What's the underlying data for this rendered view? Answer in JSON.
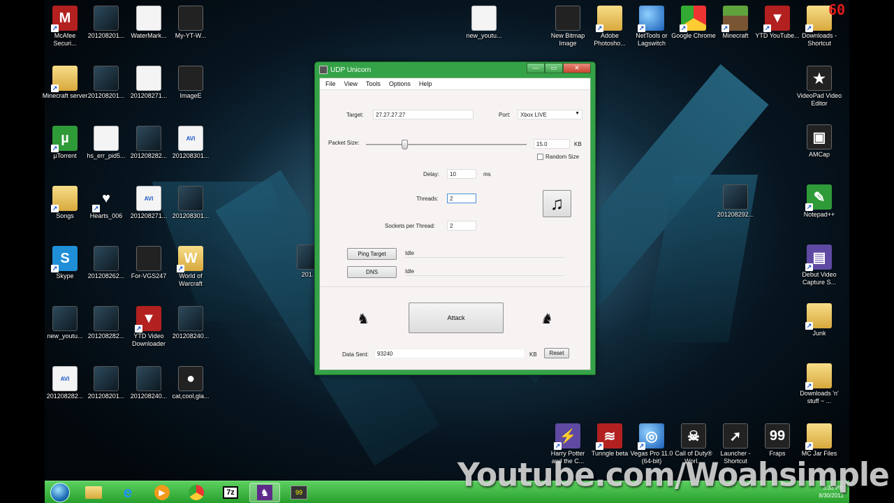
{
  "desktop": {
    "icons_left": [
      {
        "label": "McAfee Securi...",
        "icon": "mcafee-icon"
      },
      {
        "label": "201208201...",
        "icon": "video-thumb-icon"
      },
      {
        "label": "WaterMark...",
        "icon": "document-icon"
      },
      {
        "label": "My-YT-W...",
        "icon": "app-icon"
      },
      {
        "label": "Minecraft server",
        "icon": "folder-icon"
      },
      {
        "label": "201208201...",
        "icon": "video-thumb-icon"
      },
      {
        "label": "201208271...",
        "icon": "document-icon"
      },
      {
        "label": "ImageE",
        "icon": "app-icon"
      },
      {
        "label": "µTorrent",
        "icon": "utorrent-icon"
      },
      {
        "label": "hs_err_pid5...",
        "icon": "document-icon"
      },
      {
        "label": "201208282...",
        "icon": "video-thumb-icon"
      },
      {
        "label": "201208301...",
        "icon": "avi-icon"
      },
      {
        "label": "Songs",
        "icon": "folder-icon"
      },
      {
        "label": "Hearts_006",
        "icon": "heart-icon"
      },
      {
        "label": "201208271...",
        "icon": "avi-icon"
      },
      {
        "label": "201208301...",
        "icon": "video-thumb-icon"
      },
      {
        "label": "Skype",
        "icon": "skype-icon"
      },
      {
        "label": "201208262...",
        "icon": "video-thumb-icon"
      },
      {
        "label": "For-VGS247",
        "icon": "app-icon"
      },
      {
        "label": "World of Warcraft",
        "icon": "wow-icon"
      },
      {
        "label": "new_youtu...",
        "icon": "video-thumb-icon"
      },
      {
        "label": "201208282...",
        "icon": "video-thumb-icon"
      },
      {
        "label": "YTD Video Downloader",
        "icon": "ytd-icon"
      },
      {
        "label": "201208240...",
        "icon": "video-thumb-icon"
      },
      {
        "label": "201208282...",
        "icon": "avi-icon"
      },
      {
        "label": "201208201...",
        "icon": "video-thumb-icon"
      },
      {
        "label": "201208240...",
        "icon": "video-thumb-icon"
      },
      {
        "label": "cat,cool,gla...",
        "icon": "image-icon"
      }
    ],
    "icons_top": [
      {
        "label": "new_youtu...",
        "icon": "document-icon"
      },
      {
        "label": "New Bitmap Image",
        "icon": "bitmap-icon"
      },
      {
        "label": "Adobe Photosho...",
        "icon": "folder-icon"
      },
      {
        "label": "NetTools or Lagswitch",
        "icon": "globe-icon"
      },
      {
        "label": "Google Chrome",
        "icon": "chrome-icon"
      },
      {
        "label": "Minecraft",
        "icon": "minecraft-icon"
      },
      {
        "label": "YTD YouTube...",
        "icon": "ytd-icon"
      },
      {
        "label": "Downloads - Shortcut",
        "icon": "folder-icon"
      }
    ],
    "icons_right": [
      {
        "label": "VideoPad Video Editor",
        "icon": "videopad-icon"
      },
      {
        "label": "AMCap",
        "icon": "amcap-icon"
      },
      {
        "label": "Notepad++",
        "icon": "notepad-icon"
      },
      {
        "label": "Debut Video Capture S...",
        "icon": "debut-icon"
      },
      {
        "label": "Junk",
        "icon": "folder-icon"
      },
      {
        "label": "Downloads 'n' stuff ~ ...",
        "icon": "folder-icon"
      },
      {
        "label": "MC Jar Files",
        "icon": "folder-icon"
      }
    ],
    "icons_bottom": [
      {
        "label": "Harry Potter and the C...",
        "icon": "hp-icon"
      },
      {
        "label": "Tunngle beta",
        "icon": "tunngle-icon"
      },
      {
        "label": "Vegas Pro 11.0 (64-bit)",
        "icon": "vegas-icon"
      },
      {
        "label": "Call of Duty® Worl...",
        "icon": "cod-icon"
      },
      {
        "label": "Launcher - Shortcut",
        "icon": "launcher-icon"
      },
      {
        "label": "Fraps",
        "icon": "fraps-icon"
      }
    ],
    "icons_misc": [
      {
        "label": "201208292...",
        "icon": "video-thumb-icon"
      },
      {
        "label": "201...",
        "icon": "video-thumb-icon"
      }
    ]
  },
  "window": {
    "title": "UDP Unicorn",
    "controls": {
      "minimize": "—",
      "maximize": "▭",
      "close": "✕"
    },
    "menu": [
      "File",
      "View",
      "Tools",
      "Options",
      "Help"
    ],
    "target_label": "Target:",
    "target_value": "27.27.27.27",
    "port_label": "Port:",
    "port_value": "Xbox LIVE",
    "packet_size_label": "Packet Size:",
    "packet_size_value": "15.0",
    "packet_size_unit": "KB",
    "packet_size_level": 0.24,
    "random_size_label": "Random Size",
    "random_size_checked": false,
    "delay_label": "Delay:",
    "delay_value": "10",
    "delay_unit": "ms",
    "threads_label": "Threads:",
    "threads_value": "2",
    "sockets_label": "Sockets per Thread:",
    "sockets_value": "2",
    "ping_button": "Ping Target",
    "ping_status": "Idle",
    "dns_button": "DNS",
    "dns_status": "Idle",
    "attack_button": "Attack",
    "data_sent_label": "Data Sent:",
    "data_sent_value": "93240",
    "data_sent_unit": "KB",
    "reset_button": "Reset"
  },
  "taskbar": {
    "items": [
      "start-orb",
      "explorer-icon",
      "ie-icon",
      "media-player-icon",
      "chrome-icon",
      "7zip-icon",
      "udp-unicorn-icon",
      "fraps-icon"
    ],
    "seven_zip_label": "7z",
    "time": "3:33 PM",
    "date": "8/30/2012"
  },
  "overlay": {
    "watermark": "Youtube.com/Woahsimple",
    "fps": "60"
  }
}
